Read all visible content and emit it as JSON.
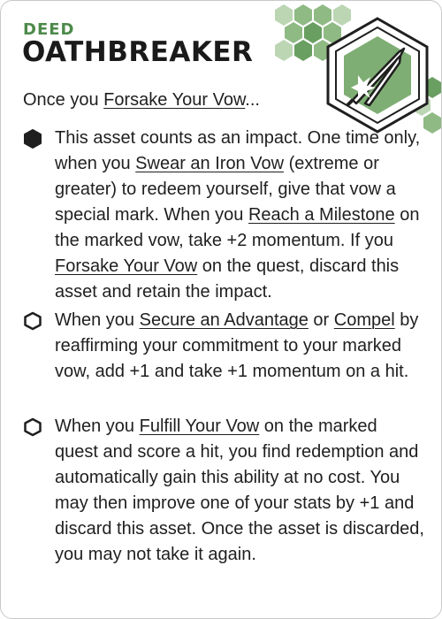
{
  "card": {
    "kind": "DEED",
    "title": "OATHBREAKER",
    "intro": {
      "before": "Once you ",
      "link": "Forsake Your Vow",
      "after": "..."
    },
    "colors": {
      "accent_green": "#4d8a4a",
      "hex_light": "#8fba84",
      "hex_mid": "#6a9f62",
      "icon_bg": "#7fae74"
    },
    "icon": "crossed-swords-icon",
    "abilities": [
      {
        "enabled": true,
        "marker_icon": "filled-hexagon-icon",
        "segments": [
          {
            "t": "This asset counts as an impact. One time only, when you "
          },
          {
            "t": "Swear an Iron Vow",
            "link": true
          },
          {
            "t": " (extreme or greater) to redeem yourself, give that vow a special mark. When you "
          },
          {
            "t": "Reach a Milestone",
            "link": true
          },
          {
            "t": " on the marked vow, take +2 momentum. If you "
          },
          {
            "t": "Forsake Your Vow",
            "link": true
          },
          {
            "t": " on the quest, discard this asset and retain the impact."
          }
        ]
      },
      {
        "enabled": false,
        "marker_icon": "empty-hexagon-icon",
        "segments": [
          {
            "t": "When you "
          },
          {
            "t": "Secure an Advantage",
            "link": true
          },
          {
            "t": " or "
          },
          {
            "t": "Compel",
            "link": true
          },
          {
            "t": " by reaffirming your commitment to your marked vow, add +1 and take +1 momentum on a hit."
          }
        ]
      },
      {
        "enabled": false,
        "marker_icon": "empty-hexagon-icon",
        "segments": [
          {
            "t": "When you "
          },
          {
            "t": "Fulfill Your Vow",
            "link": true
          },
          {
            "t": " on the marked quest and score a hit, you find redemption and automatically gain this ability at no cost. You may then improve one of your stats by +1 and discard this asset. Once the asset is discarded, you may not take it again."
          }
        ]
      }
    ]
  }
}
